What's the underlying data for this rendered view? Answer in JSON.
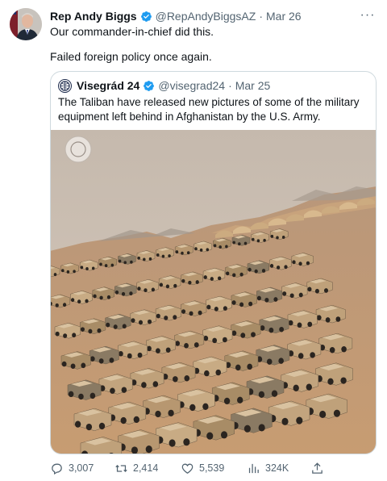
{
  "tweet": {
    "author_name": "Rep Andy Biggs",
    "handle": "@RepAndyBiggsAZ",
    "separator": "·",
    "date": "Mar 26",
    "more_label": "···",
    "lines": [
      "Our commander-in-chief did this.",
      "Failed foreign policy once again."
    ]
  },
  "quote": {
    "author_name": "Visegrád 24",
    "handle": "@visegrad24",
    "separator": "·",
    "date": "Mar 25",
    "text": "The Taliban have released new pictures of some of the military equipment left behind in Afghanistan by the U.S. Army.",
    "media_icon": "photo-military-vehicles"
  },
  "actions": {
    "replies": "3,007",
    "retweets": "2,414",
    "likes": "5,539",
    "views": "324K"
  },
  "colors": {
    "verified_blue": "#1d9bf0",
    "text_primary": "#0f1419",
    "text_secondary": "#536471",
    "border": "#cfd9de",
    "sky": "#cdc2b6",
    "ground": "#c49a74",
    "vehicle": "#b99a72"
  }
}
